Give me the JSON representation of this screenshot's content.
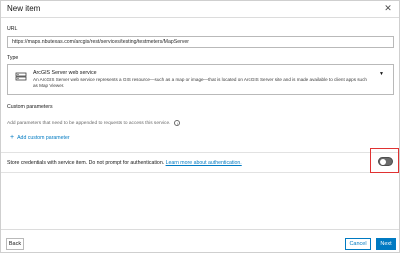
{
  "header": {
    "title": "New item",
    "close_icon": "close-icon"
  },
  "url": {
    "label": "URL",
    "value": "https://maps.nbutexas.com/arcgis/rest/services/testing/testmeters/MapServer"
  },
  "type": {
    "label": "Type",
    "selected_name": "ArcGIS Server web service",
    "selected_description": "An ArcGIS Server web service represents a GIS resource—such as a map or image—that is located on ArcGIS Server site and is made available to client apps such as Map Viewer.",
    "icon": "server-icon"
  },
  "custom_parameters": {
    "title": "Custom parameters",
    "description": "Add parameters that need to be appended to requests to access this service.",
    "add_label": "Add custom parameter"
  },
  "credentials": {
    "text": "Store credentials with service item. Do not prompt for authentication.",
    "link": "Learn more about authentication.",
    "toggle_on": false
  },
  "footer": {
    "back": "Back",
    "cancel": "Cancel",
    "next": "Next"
  },
  "colors": {
    "accent": "#007ac2",
    "highlight": "#e03232",
    "toggle_off": "#6a6a6a"
  }
}
